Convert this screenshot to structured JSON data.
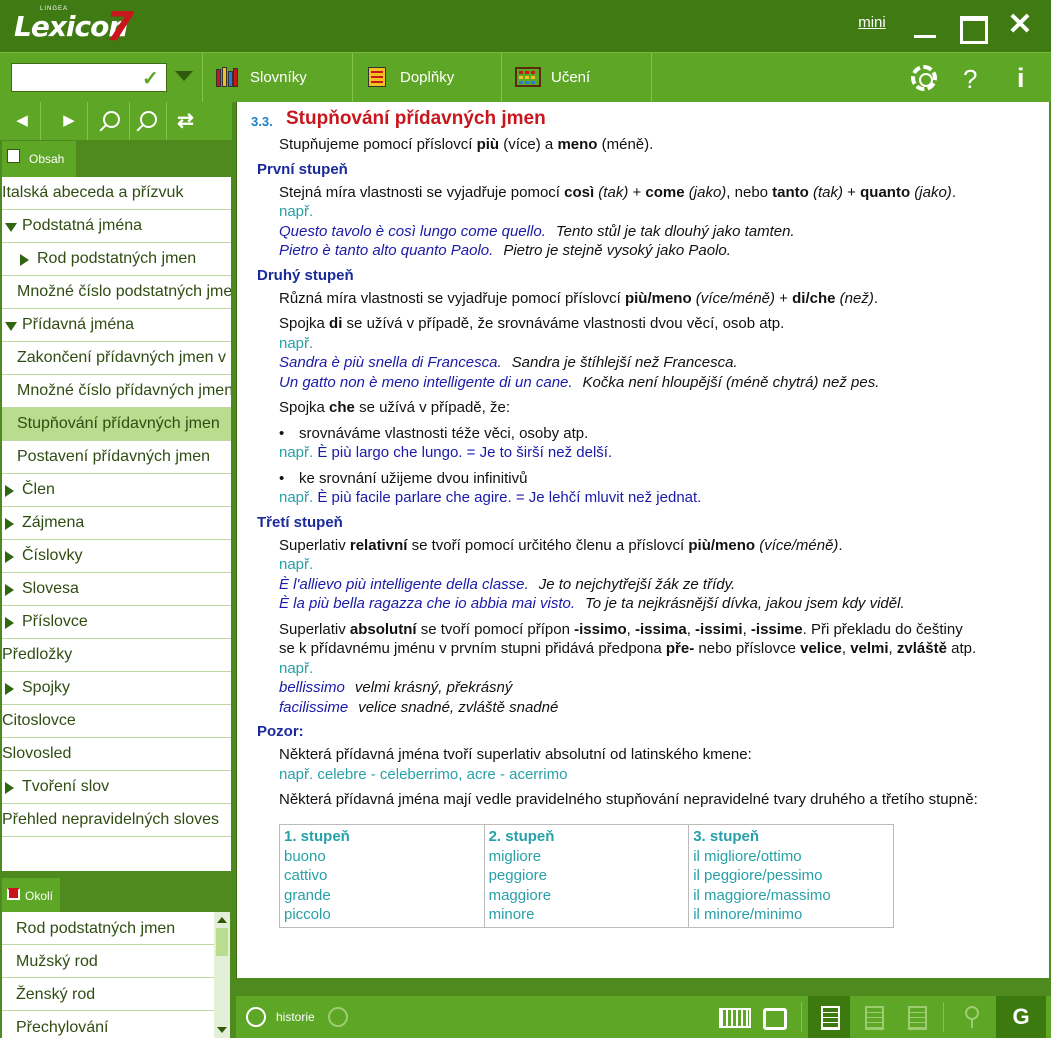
{
  "window": {
    "logo_brand": "Lexicon",
    "logo_version": "7",
    "logo_maker": "LINGEA",
    "mini_label": "mini",
    "close_glyph": "✕"
  },
  "toolbar": {
    "search": {
      "value": "",
      "placeholder": ""
    },
    "check_glyph": "✓",
    "tabs": [
      {
        "label": "Slovníky",
        "icon": "books-icon"
      },
      {
        "label": "Doplňky",
        "icon": "binder-icon"
      },
      {
        "label": "Učení",
        "icon": "abacus-icon"
      }
    ],
    "help_glyph": "?",
    "info_glyph": "i"
  },
  "left_nav": {
    "back_glyph": "◀",
    "forward_glyph": "▶",
    "sync_glyph": "⇄",
    "obsah_label": "Obsah",
    "tree": [
      {
        "label": "Italská abeceda a přízvuk",
        "level": 0,
        "arrow": "none"
      },
      {
        "label": "Podstatná jména",
        "level": 0,
        "arrow": "down"
      },
      {
        "label": "Rod podstatných jmen",
        "level": 1,
        "arrow": "right"
      },
      {
        "label": "Množné číslo podstatných jmen",
        "level": 1,
        "arrow": "none"
      },
      {
        "label": "Přídavná jména",
        "level": 0,
        "arrow": "down"
      },
      {
        "label": "Zakončení přídavných jmen v",
        "level": 1,
        "arrow": "none"
      },
      {
        "label": "Množné číslo přídavných jmen",
        "level": 1,
        "arrow": "none"
      },
      {
        "label": "Stupňování přídavných jmen",
        "level": 1,
        "arrow": "none",
        "selected": true
      },
      {
        "label": "Postavení přídavných jmen",
        "level": 1,
        "arrow": "none"
      },
      {
        "label": "Člen",
        "level": 0,
        "arrow": "right"
      },
      {
        "label": "Zájmena",
        "level": 0,
        "arrow": "right"
      },
      {
        "label": "Číslovky",
        "level": 0,
        "arrow": "right"
      },
      {
        "label": "Slovesa",
        "level": 0,
        "arrow": "right"
      },
      {
        "label": "Příslovce",
        "level": 0,
        "arrow": "right"
      },
      {
        "label": "Předložky",
        "level": 0,
        "arrow": "none"
      },
      {
        "label": "Spojky",
        "level": 0,
        "arrow": "right"
      },
      {
        "label": "Citoslovce",
        "level": 0,
        "arrow": "none"
      },
      {
        "label": "Slovosled",
        "level": 0,
        "arrow": "none"
      },
      {
        "label": "Tvoření slov",
        "level": 0,
        "arrow": "right"
      },
      {
        "label": "Přehled nepravidelných sloves",
        "level": 0,
        "arrow": "none"
      }
    ],
    "okoli_label": "Okolí",
    "okoli": [
      "Rod podstatných jmen",
      "Mužský rod",
      "Ženský rod",
      "Přechylování"
    ]
  },
  "content": {
    "section_number": "3.3.",
    "title": "Stupňování přídavných jmen",
    "intro": [
      "Stupňujeme pomocí příslovcí ",
      "più",
      " (více) a ",
      "meno",
      " (méně)."
    ],
    "napr": "např.",
    "h_prvni": "První stupeň",
    "prvni_text": [
      "Stejná míra vlastnosti se vyjadřuje pomocí ",
      "così",
      " (tak)",
      " + ",
      "come",
      " (jako)",
      ", nebo ",
      "tanto",
      " (tak)",
      " + ",
      "quanto",
      " (jako)",
      "."
    ],
    "prvni_ex": [
      {
        "it": "Questo tavolo è così lungo come quello.",
        "cz": "Tento stůl je tak dlouhý jako tamten."
      },
      {
        "it": "Pietro è tanto alto quanto Paolo.",
        "cz": "Pietro je stejně vysoký jako Paolo."
      }
    ],
    "h_druhy": "Druhý stupeň",
    "druhy_text": [
      "Různá míra vlastnosti se vyjadřuje pomocí příslovcí ",
      "più/meno",
      " (více/méně)",
      " + ",
      "di/che",
      " (než)",
      "."
    ],
    "di_text": [
      "Spojka ",
      "di",
      " se užívá v případě, že srovnáváme vlastnosti dvou věcí, osob atp."
    ],
    "druhy_ex": [
      {
        "it": "Sandra è più snella di Francesca.",
        "cz": "Sandra je štíhlejší než Francesca."
      },
      {
        "it": "Un gatto non è meno intelligente di un cane.",
        "cz": "Kočka není hloupější (méně chytrá) než pes."
      }
    ],
    "che_text": [
      "Spojka ",
      "che",
      " se užívá v případě, že:"
    ],
    "bullet1": "srovnáváme vlastnosti téže věci, osoby atp.",
    "bullet1_ex": "È più largo che lungo. = Je to širší než delší.",
    "bullet2": "ke srovnání užijeme dvou infinitivů",
    "bullet2_ex": "È più facile parlare che agire. = Je lehčí mluvit než jednat.",
    "h_treti": "Třetí stupeň",
    "treti_text": [
      "Superlativ ",
      "relativní",
      " se tvoří pomocí určitého členu a příslovcí ",
      "più/meno",
      " (více/méně)",
      "."
    ],
    "treti_ex": [
      {
        "it": "È l'allievo più intelligente della classe.",
        "cz": "Je to nejchytřejší žák ze třídy."
      },
      {
        "it": "È la più bella ragazza che io abbia mai visto.",
        "cz": "To je ta nejkrásnější dívka, jakou jsem kdy viděl."
      }
    ],
    "abs_line1": [
      "Superlativ ",
      "absolutní",
      " se tvoří pomocí přípon ",
      "-issimo",
      ", ",
      "-issima",
      ", ",
      "-issimi",
      ", ",
      "-issime",
      ". Při překladu do češtiny"
    ],
    "abs_line2": [
      "se k přídavnému jménu v prvním stupni přidává předpona ",
      "pře-",
      " nebo příslovce ",
      "velice",
      ", ",
      "velmi",
      ", ",
      "zvláště",
      " atp."
    ],
    "abs_ex": [
      {
        "it": "bellissimo",
        "cz": "velmi krásný, překrásný"
      },
      {
        "it": "facilissime",
        "cz": "velice snadné, zvláště snadné"
      }
    ],
    "h_pozor": "Pozor:",
    "pozor_text": "Některá přídavná jména tvoří superlativ absolutní od latinského kmene:",
    "pozor_ex": "celebre - celeberrimo, acre - acerrimo",
    "irreg_text": "Některá přídavná jména mají vedle pravidelného stupňování nepravidelné tvary druhého a třetího stupně:",
    "table": {
      "headers": [
        "1. stupeň",
        "2. stupeň",
        "3. stupeň"
      ],
      "rows": [
        [
          "buono",
          "migliore",
          "il migliore/ottimo"
        ],
        [
          "cattivo",
          "peggiore",
          "il peggiore/pessimo"
        ],
        [
          "grande",
          "maggiore",
          "il maggiore/massimo"
        ],
        [
          "piccolo",
          "minore",
          "il minore/minimo"
        ]
      ]
    }
  },
  "statusbar": {
    "history_label": "historie",
    "g_label": "G"
  }
}
